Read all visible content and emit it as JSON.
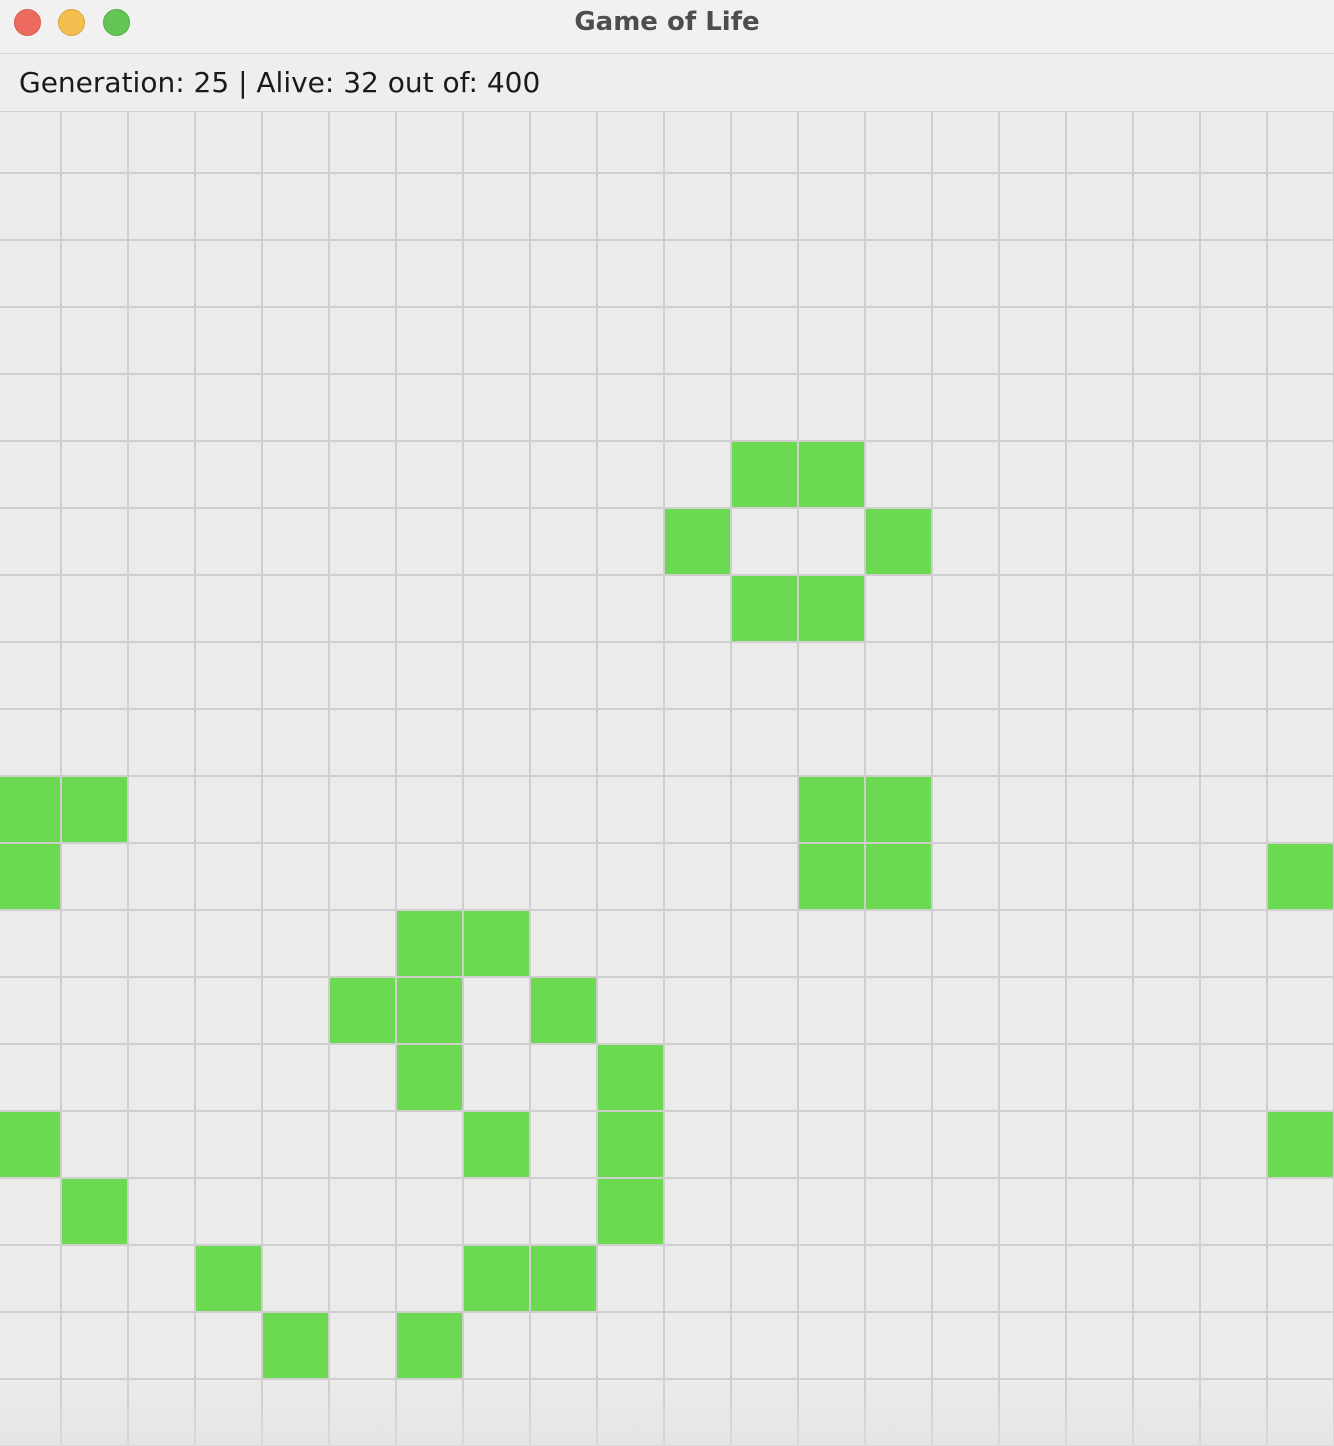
{
  "window": {
    "title": "Game of Life"
  },
  "status": {
    "text": "Generation: 25 | Alive: 32 out of: 400",
    "generation": 25,
    "alive": 32,
    "total": 400
  },
  "colors": {
    "alive": "#6cda50",
    "dead": "#ebebeb",
    "gridline": "#cfcfcf"
  },
  "board": {
    "rows": 20,
    "cols": 20,
    "alive_cells": [
      [
        5,
        11
      ],
      [
        5,
        12
      ],
      [
        6,
        10
      ],
      [
        6,
        13
      ],
      [
        7,
        11
      ],
      [
        7,
        12
      ],
      [
        10,
        0
      ],
      [
        10,
        1
      ],
      [
        10,
        12
      ],
      [
        10,
        13
      ],
      [
        11,
        0
      ],
      [
        11,
        12
      ],
      [
        11,
        13
      ],
      [
        11,
        19
      ],
      [
        12,
        6
      ],
      [
        12,
        7
      ],
      [
        13,
        5
      ],
      [
        13,
        6
      ],
      [
        13,
        8
      ],
      [
        14,
        6
      ],
      [
        14,
        9
      ],
      [
        15,
        0
      ],
      [
        15,
        7
      ],
      [
        15,
        9
      ],
      [
        15,
        19
      ],
      [
        16,
        1
      ],
      [
        16,
        9
      ],
      [
        17,
        3
      ],
      [
        17,
        7
      ],
      [
        17,
        8
      ],
      [
        18,
        4
      ],
      [
        18,
        6
      ]
    ]
  }
}
